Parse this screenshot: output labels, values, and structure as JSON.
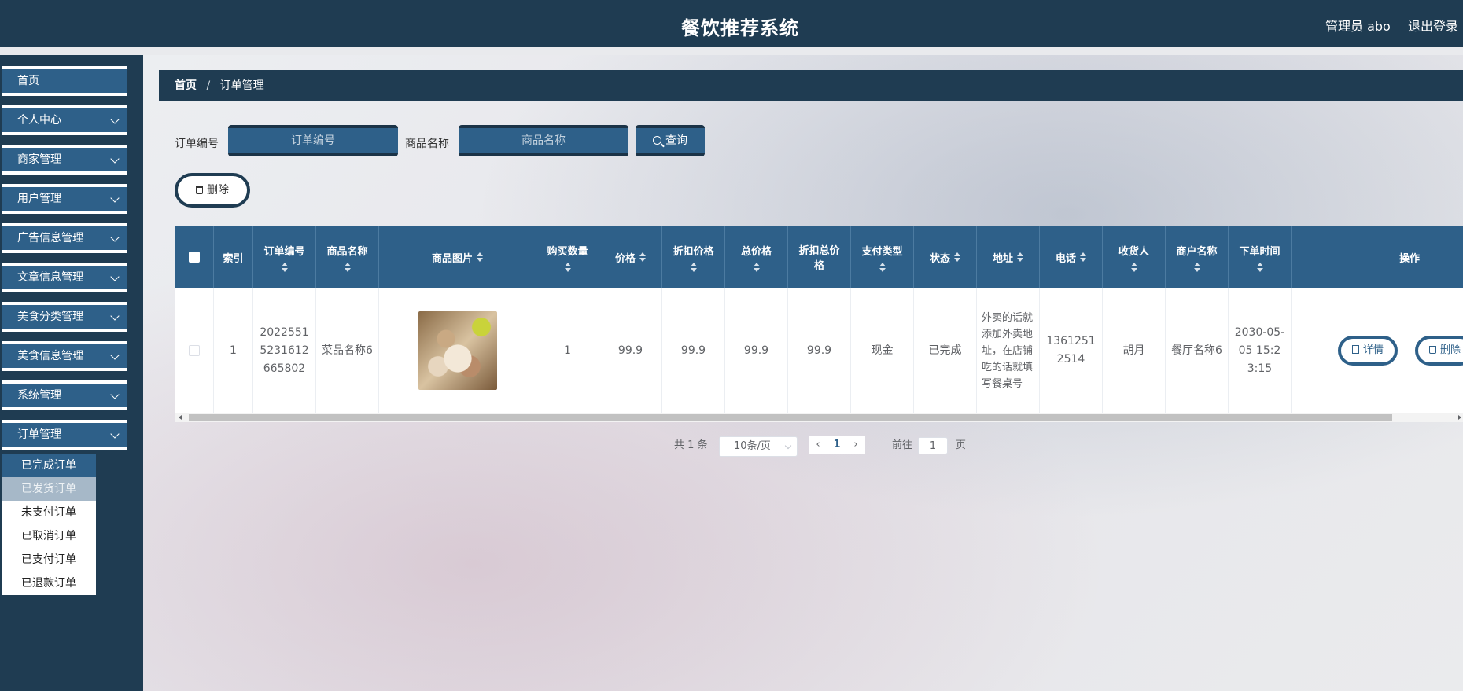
{
  "header": {
    "title": "餐饮推荐系统",
    "user": "管理员 abo",
    "logout": "退出登录"
  },
  "sidebar": {
    "items": [
      {
        "label": "首页"
      },
      {
        "label": "个人中心"
      },
      {
        "label": "商家管理"
      },
      {
        "label": "用户管理"
      },
      {
        "label": "广告信息管理"
      },
      {
        "label": "文章信息管理"
      },
      {
        "label": "美食分类管理"
      },
      {
        "label": "美食信息管理"
      },
      {
        "label": "系统管理"
      },
      {
        "label": "订单管理"
      }
    ],
    "submenu": [
      {
        "label": "已完成订单"
      },
      {
        "label": "已发货订单"
      },
      {
        "label": "未支付订单"
      },
      {
        "label": "已取消订单"
      },
      {
        "label": "已支付订单"
      },
      {
        "label": "已退款订单"
      }
    ]
  },
  "breadcrumb": {
    "home": "首页",
    "separator": "/",
    "current": "订单管理"
  },
  "search": {
    "order_no_label": "订单编号",
    "order_no_placeholder": "订单编号",
    "product_label": "商品名称",
    "product_placeholder": "商品名称",
    "query_label": "查询"
  },
  "actions": {
    "delete_label": "删除"
  },
  "table": {
    "headers": {
      "index": "索引",
      "order_no": "订单编号",
      "product_name": "商品名称",
      "product_image": "商品图片",
      "quantity": "购买数量",
      "price": "价格",
      "discount_price": "折扣价格",
      "total_price": "总价格",
      "discount_total": "折扣总价格",
      "pay_type": "支付类型",
      "status": "状态",
      "address": "地址",
      "phone": "电话",
      "consignee": "收货人",
      "merchant": "商户名称",
      "order_time": "下单时间",
      "operation": "操作"
    },
    "rows": [
      {
        "index": "1",
        "order_no": "20225515231612665802",
        "product_name": "菜品名称6",
        "quantity": "1",
        "price": "99.9",
        "discount_price": "99.9",
        "total_price": "99.9",
        "discount_total": "99.9",
        "pay_type": "现金",
        "status": "已完成",
        "address": "外卖的话就添加外卖地址，在店铺吃的话就填写餐桌号",
        "phone": "13612512514",
        "consignee": "胡月",
        "merchant": "餐厅名称6",
        "order_time": "2030-05-05 15:23:15",
        "detail_label": "详情",
        "delete_label": "删除"
      }
    ]
  },
  "pagination": {
    "total": "共 1 条",
    "page_size": "10条/页",
    "current_page": "1",
    "goto_prefix": "前往",
    "goto_value": "1",
    "goto_suffix": "页"
  },
  "colors": {
    "header_bg": "#1f3c52",
    "accent": "#2e6089"
  }
}
